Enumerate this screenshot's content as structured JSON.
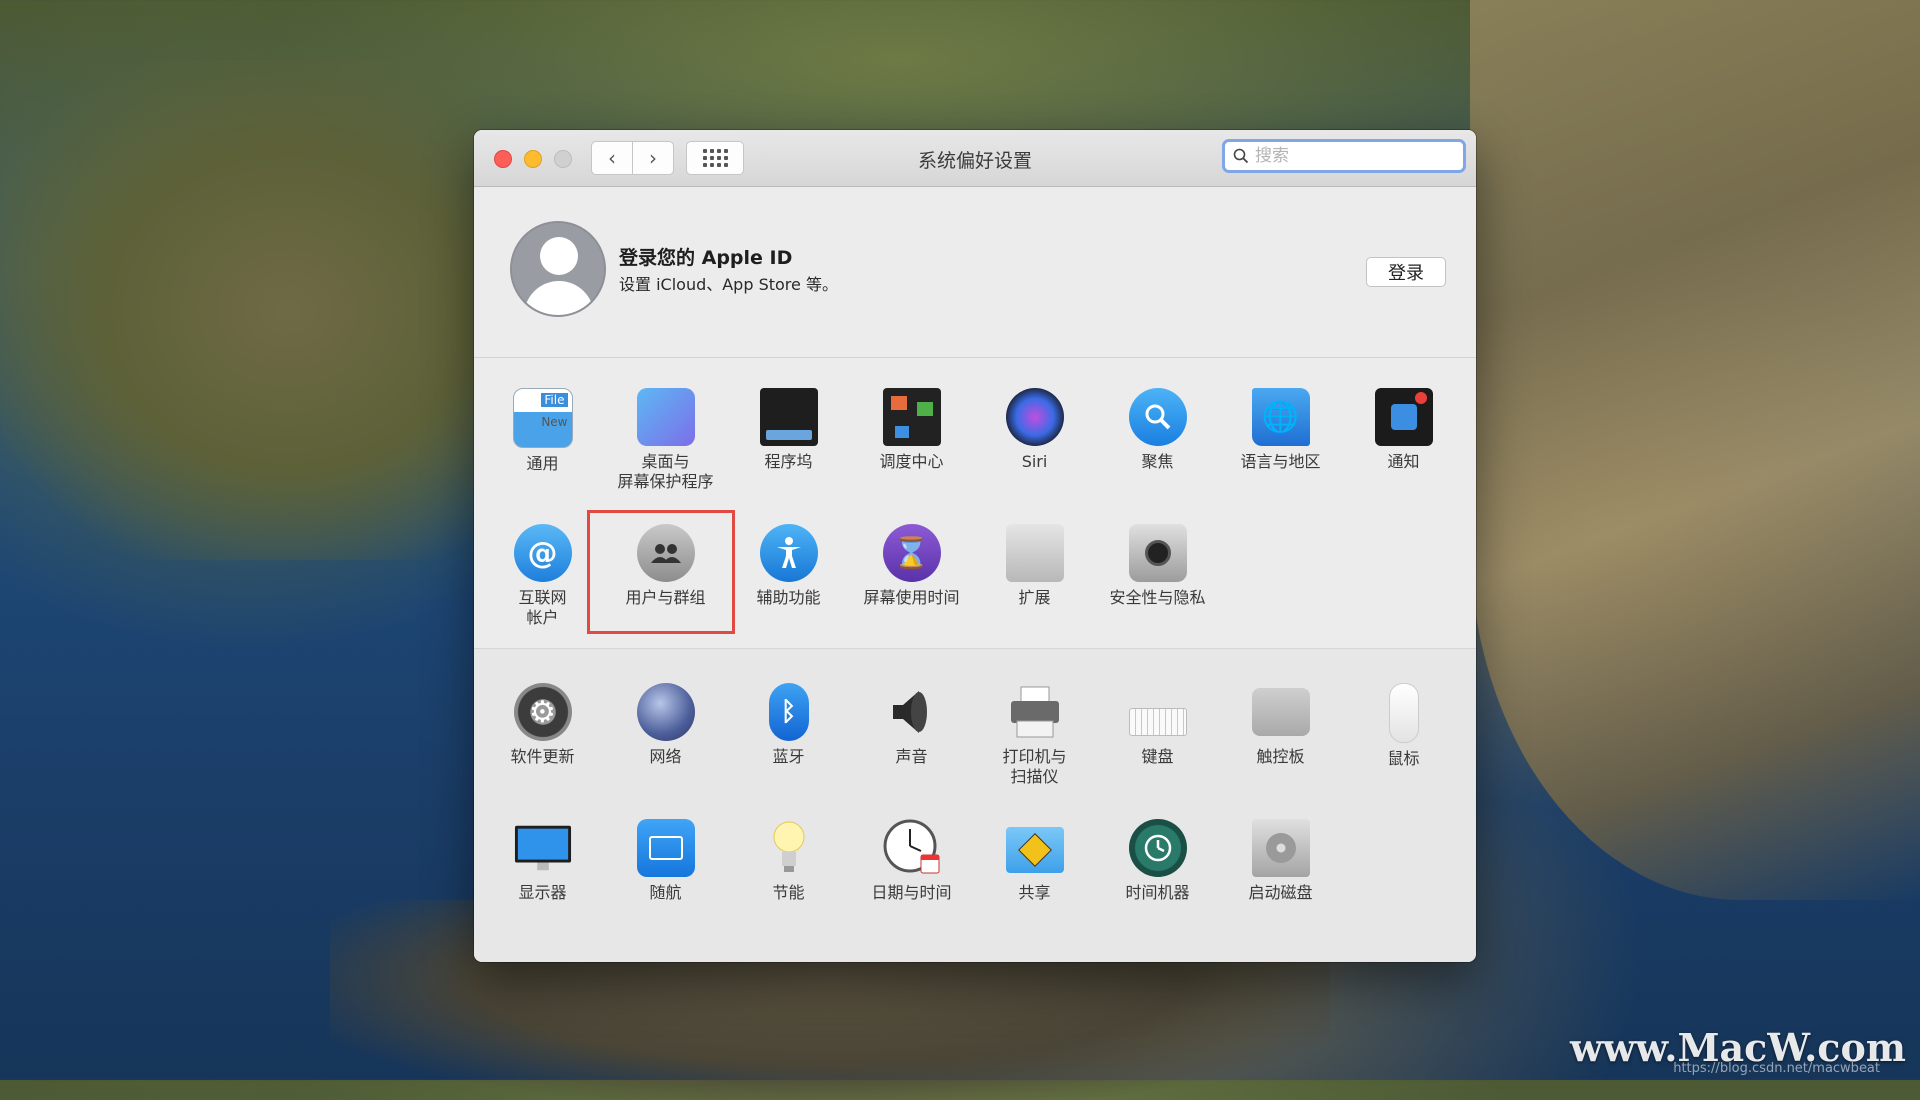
{
  "window": {
    "title": "系统偏好设置",
    "search_placeholder": "搜索"
  },
  "account": {
    "title": "登录您的 Apple ID",
    "subtitle": "设置 iCloud、App Store 等。",
    "login_label": "登录"
  },
  "top_panes": [
    {
      "label": "通用",
      "icon": "general-icon"
    },
    {
      "label": "桌面与\n屏幕保护程序",
      "icon": "desktop-icon"
    },
    {
      "label": "程序坞",
      "icon": "dock-icon"
    },
    {
      "label": "调度中心",
      "icon": "mission-control-icon"
    },
    {
      "label": "Siri",
      "icon": "siri-icon"
    },
    {
      "label": "聚焦",
      "icon": "spotlight-icon"
    },
    {
      "label": "语言与地区",
      "icon": "language-flag-icon"
    },
    {
      "label": "通知",
      "icon": "notifications-icon"
    },
    {
      "label": "互联网\n帐户",
      "icon": "internet-accounts-icon"
    },
    {
      "label": "用户与群组",
      "icon": "users-groups-icon"
    },
    {
      "label": "辅助功能",
      "icon": "accessibility-icon"
    },
    {
      "label": "屏幕使用时间",
      "icon": "screen-time-icon"
    },
    {
      "label": "扩展",
      "icon": "extensions-icon"
    },
    {
      "label": "安全性与隐私",
      "icon": "security-icon"
    }
  ],
  "bottom_panes": [
    {
      "label": "软件更新",
      "icon": "software-update-icon"
    },
    {
      "label": "网络",
      "icon": "network-icon"
    },
    {
      "label": "蓝牙",
      "icon": "bluetooth-icon"
    },
    {
      "label": "声音",
      "icon": "sound-icon"
    },
    {
      "label": "打印机与\n扫描仪",
      "icon": "printer-icon"
    },
    {
      "label": "键盘",
      "icon": "keyboard-icon"
    },
    {
      "label": "触控板",
      "icon": "trackpad-icon"
    },
    {
      "label": "鼠标",
      "icon": "mouse-icon"
    },
    {
      "label": "显示器",
      "icon": "display-icon"
    },
    {
      "label": "随航",
      "icon": "sidecar-icon"
    },
    {
      "label": "节能",
      "icon": "energy-saver-icon"
    },
    {
      "label": "日期与时间",
      "icon": "date-time-icon"
    },
    {
      "label": "共享",
      "icon": "sharing-icon"
    },
    {
      "label": "时间机器",
      "icon": "time-machine-icon"
    },
    {
      "label": "启动磁盘",
      "icon": "startup-disk-icon"
    }
  ],
  "watermark": {
    "brand": "www.MacW.com",
    "url": "https://blog.csdn.net/macwbeat"
  },
  "colors": {
    "highlight": "#e04a43",
    "search_focus": "#7fa6e6"
  }
}
